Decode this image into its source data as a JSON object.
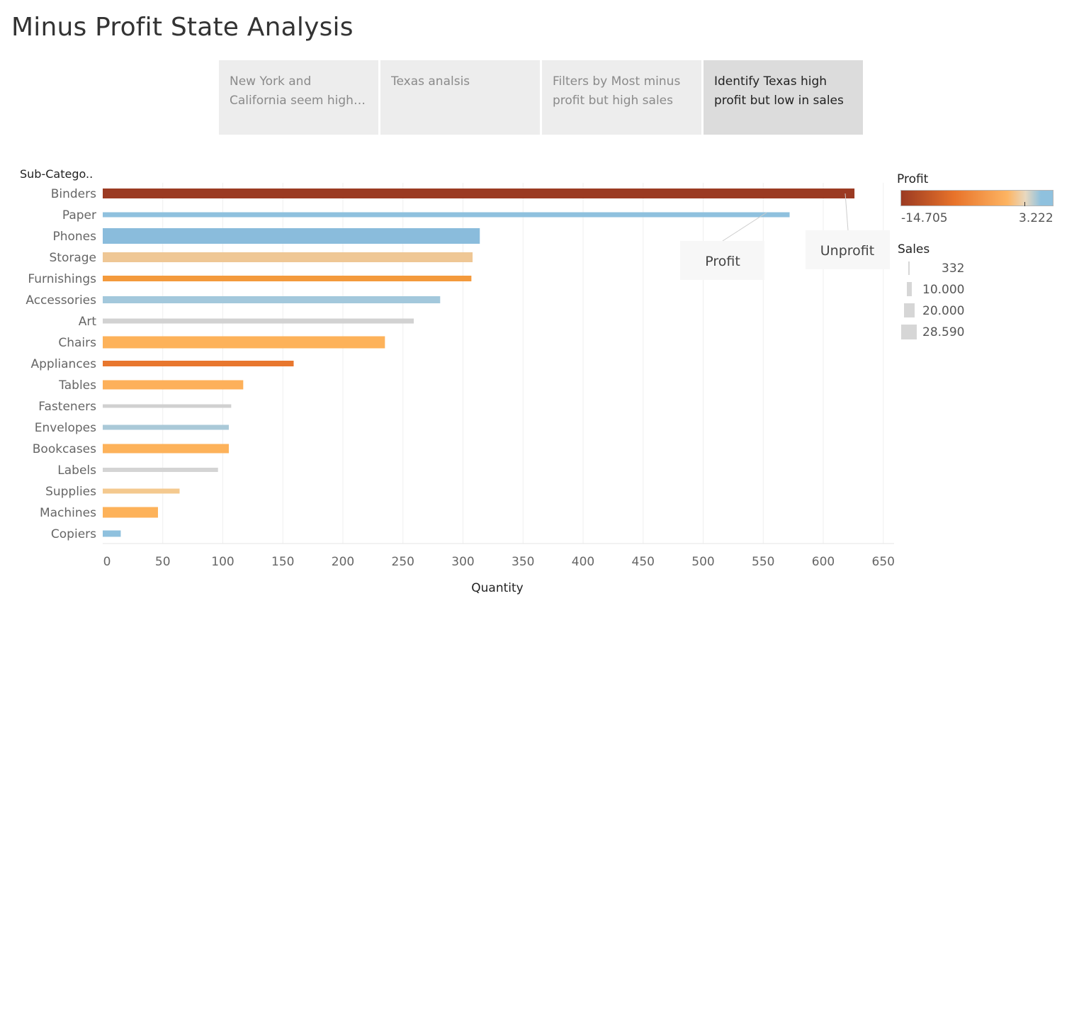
{
  "title": "Minus Profit State Analysis",
  "story_points": [
    {
      "caption": "New York and California seem high in minus profit",
      "active": false
    },
    {
      "caption": "Texas analsis",
      "active": false
    },
    {
      "caption": "Filters by Most minus profit but high sales",
      "active": false
    },
    {
      "caption": "Identify Texas high profit but low in sales",
      "active": true
    }
  ],
  "legend": {
    "profit_title": "Profit",
    "profit_min": "-14.705",
    "profit_max": "3.222",
    "profit_colors": [
      "#9b3a22",
      "#e8732a",
      "#fdb462",
      "#e8d8bf",
      "#8fc1de"
    ],
    "sales_title": "Sales",
    "sales_items": [
      "332",
      "10.000",
      "20.000",
      "28.590"
    ]
  },
  "annotations": [
    {
      "text": "Profit"
    },
    {
      "text": "Unprofit"
    }
  ],
  "chart_data": {
    "type": "bar",
    "orientation": "horizontal",
    "row_header": "Sub-Catego..",
    "xlabel": "Quantity",
    "xlim": [
      0,
      650
    ],
    "xticks": [
      0,
      50,
      100,
      150,
      200,
      250,
      300,
      350,
      400,
      450,
      500,
      550,
      600,
      650
    ],
    "grid": true,
    "categories": [
      "Binders",
      "Paper",
      "Phones",
      "Storage",
      "Furnishings",
      "Accessories",
      "Art",
      "Chairs",
      "Appliances",
      "Tables",
      "Fasteners",
      "Envelopes",
      "Bookcases",
      "Labels",
      "Supplies",
      "Machines",
      "Copiers"
    ],
    "values": [
      626,
      572,
      314,
      308,
      307,
      281,
      259,
      235,
      159,
      117,
      107,
      105,
      105,
      96,
      64,
      46,
      15
    ],
    "colors": [
      "#9b3a22",
      "#8fc1de",
      "#8abcdc",
      "#efc795",
      "#f49a3c",
      "#a3c8dc",
      "#d2d2d2",
      "#fdb25a",
      "#e8772e",
      "#fdb05a",
      "#d0d0d0",
      "#aac9d8",
      "#fdb25a",
      "#d4d4d4",
      "#f4c98f",
      "#fdb25a",
      "#8fc1de"
    ],
    "bar_sales": [
      9000,
      1500,
      28590,
      9500,
      2000,
      4200,
      1200,
      16000,
      1800,
      8500,
      332,
      1000,
      7500,
      600,
      1200,
      11500,
      3000
    ]
  }
}
